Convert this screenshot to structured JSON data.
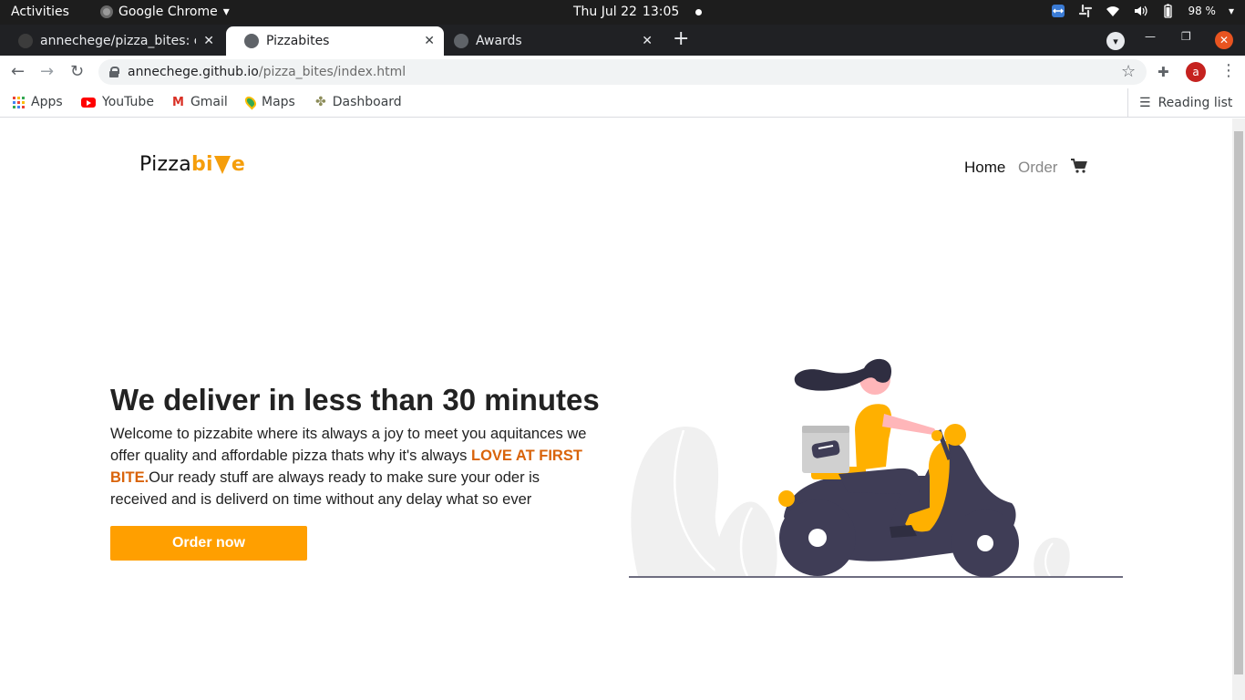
{
  "os": {
    "activities": "Activities",
    "app_menu": "Google Chrome",
    "date": "Thu Jul 22",
    "time": "13:05",
    "battery": "98 %"
  },
  "browser": {
    "tabs": [
      {
        "title": "annechege/pizza_bites: c",
        "active": false
      },
      {
        "title": "Pizzabites",
        "active": true
      },
      {
        "title": "Awards",
        "active": false
      }
    ],
    "url_host": "annechege.github.io",
    "url_path": "/pizza_bites/index.html",
    "profile_initial": "a",
    "bookmarks": [
      "Apps",
      "YouTube",
      "Gmail",
      "Maps",
      "Dashboard"
    ],
    "reading_list": "Reading list"
  },
  "site": {
    "logo_prefix": "Pizza",
    "logo_bi": "bi",
    "logo_suffix": "e",
    "nav": {
      "home": "Home",
      "order": "Order"
    },
    "hero": {
      "title": "We deliver in less than 30 minutes",
      "text_before": "Welcome to pizzabite where its always a joy to meet you aquitances we offer quality and affordable pizza thats why it's always ",
      "highlight": "LOVE AT FIRST BITE.",
      "text_after": "Our ready stuff are always ready to make sure your oder is received and is deliverd on time without any delay what so ever",
      "button": "Order now"
    },
    "colors": {
      "accent": "#ff9f00",
      "highlight": "#d9630a",
      "scooter": "#3f3d56"
    }
  }
}
